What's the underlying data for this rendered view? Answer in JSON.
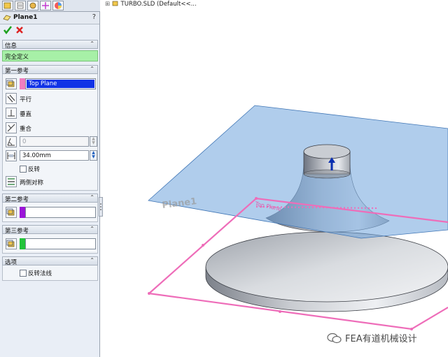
{
  "panel": {
    "title": "Plane1",
    "help": "?",
    "ok_icon": "checkmark-icon",
    "cancel_icon": "x-icon",
    "info": {
      "header": "信息",
      "status": "完全定义"
    },
    "first_ref": {
      "header": "第一参考",
      "selection": "Top Plane",
      "parallel": "平行",
      "perpendicular": "垂直",
      "coincident": "重合",
      "angle_value": "0",
      "distance_value": "34.00mm",
      "flip": "反转",
      "mid_plane": "两侧对称",
      "accent": "#f07ec0"
    },
    "second_ref": {
      "header": "第二参考",
      "accent": "#9b15d8"
    },
    "third_ref": {
      "header": "第三参考",
      "accent": "#23c43a"
    },
    "options": {
      "header": "选项",
      "flip_normal": "反转法线"
    }
  },
  "tree": {
    "text": "TURBO.SLD (Default<<..."
  },
  "viewport": {
    "plane_label": "Top Plane",
    "plane_color": "#6fa4dc",
    "sketch_color": "#ee6db9"
  },
  "watermark": {
    "text": "FEA有道机械设计"
  }
}
